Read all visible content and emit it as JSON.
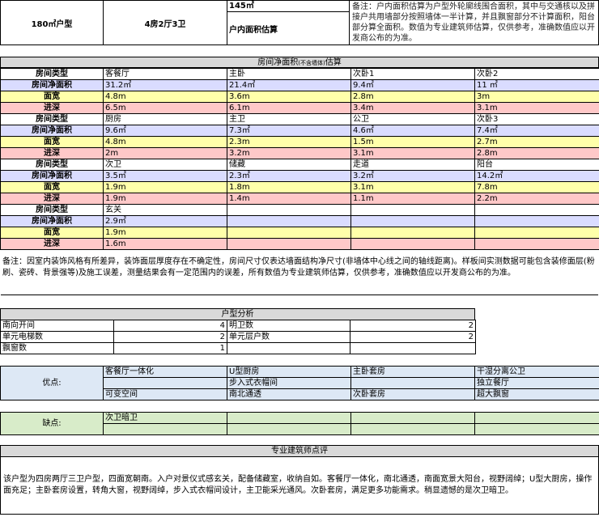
{
  "header": {
    "type": "180㎡户型",
    "layout": "4房2厅3卫",
    "area": "145㎡",
    "area_label": "户内面积估算",
    "note": "备注：户内面积估算为户型外轮廓线围合面积，其中与交通核以及拼接户共用墙部分按照墙体一半计算，并且飘窗部分不计算面积，阳台部分算全面积。数值为专业建筑师估算，仅供参考，准确数值应以开发商公布的为准。"
  },
  "rooms": {
    "title_main": "房间净面积",
    "title_small": "(不含墙体)",
    "title_end": "估算",
    "row_labels": [
      "房间类型",
      "房间净面积",
      "面宽",
      "进深"
    ],
    "groups": [
      [
        [
          "客餐厅",
          "31.2㎡",
          "4.8m",
          "6.5m"
        ],
        [
          "主卧",
          "21.4㎡",
          "3.6m",
          "6.1m"
        ],
        [
          "次卧1",
          "9.4㎡",
          "2.8m",
          "3.4m"
        ],
        [
          "次卧2",
          "11 ㎡",
          "3m",
          "3.1m"
        ]
      ],
      [
        [
          "厨房",
          "9.6㎡",
          "4.8m",
          "2m"
        ],
        [
          "主卫",
          "7.3㎡",
          "2.3m",
          "3.2m"
        ],
        [
          "公卫",
          "4.6㎡",
          "1.5m",
          "3.1m"
        ],
        [
          "次卧3",
          "7.4㎡",
          "2.7m",
          "2.8m"
        ]
      ],
      [
        [
          "次卫",
          "3.5㎡",
          "1.9m",
          "1.9m"
        ],
        [
          "储藏",
          "2.3㎡",
          "1.8m",
          "1.4m"
        ],
        [
          "走道",
          "3.2㎡",
          "3.1m",
          "1.1m"
        ],
        [
          "阳台",
          "14.2㎡",
          "7.8m",
          "2.2m"
        ]
      ],
      [
        [
          "玄关",
          "2.9㎡",
          "1.9m",
          "1.6m"
        ],
        [
          "",
          "",
          "",
          ""
        ],
        [
          "",
          "",
          "",
          ""
        ],
        [
          "",
          "",
          "",
          ""
        ]
      ]
    ],
    "note": "备注：因室内装饰风格有所差异，装饰面层厚度存在不确定性，房间尺寸仅表达墙面结构净尺寸(非墙体中心线之间的轴线距离)。样板间实测数据可能包含装修面层(粉刷、瓷砖、背景强等)及施工误差，测量结果会有一定范围内的误差，所有数值为专业建筑师估算，仅供参考，准确数值应以开发商公布的为准。"
  },
  "analysis": {
    "title": "户型分析",
    "rows": [
      [
        "南向开间",
        "4",
        "明卫数",
        "2"
      ],
      [
        "单元电梯数",
        "2",
        "单元层户数",
        "2"
      ],
      [
        "飘窗数",
        "1",
        "",
        ""
      ]
    ]
  },
  "pros": {
    "label": "优点:",
    "rows": [
      [
        "客餐厅一体化",
        "U型厨房",
        "主卧套房",
        "干湿分离公卫"
      ],
      [
        "",
        "步入式衣帽间",
        "",
        "独立餐厅"
      ],
      [
        "可变空间",
        "南北通透",
        "次卧套房",
        "超大飘窗"
      ]
    ]
  },
  "cons": {
    "label": "缺点:",
    "rows": [
      [
        "次卫暗卫",
        "",
        "",
        ""
      ],
      [
        "",
        "",
        "",
        ""
      ]
    ]
  },
  "review": {
    "title": "专业建筑师点评",
    "text": "该户型为四房两厅三卫户型，四面宽朝南。入户对景仪式感玄关，配备储藏室，收纳自如。客餐厅一体化，南北通透，南面宽景大阳台，视野阔绰；U型大厨房，操作面充足；主卧套房设置，转角大窗，视野阔绰，步入式衣帽间设计，主卫能采光通风。次卧套房，满足更多功能需求。稍显遗憾的是次卫暗卫。"
  }
}
